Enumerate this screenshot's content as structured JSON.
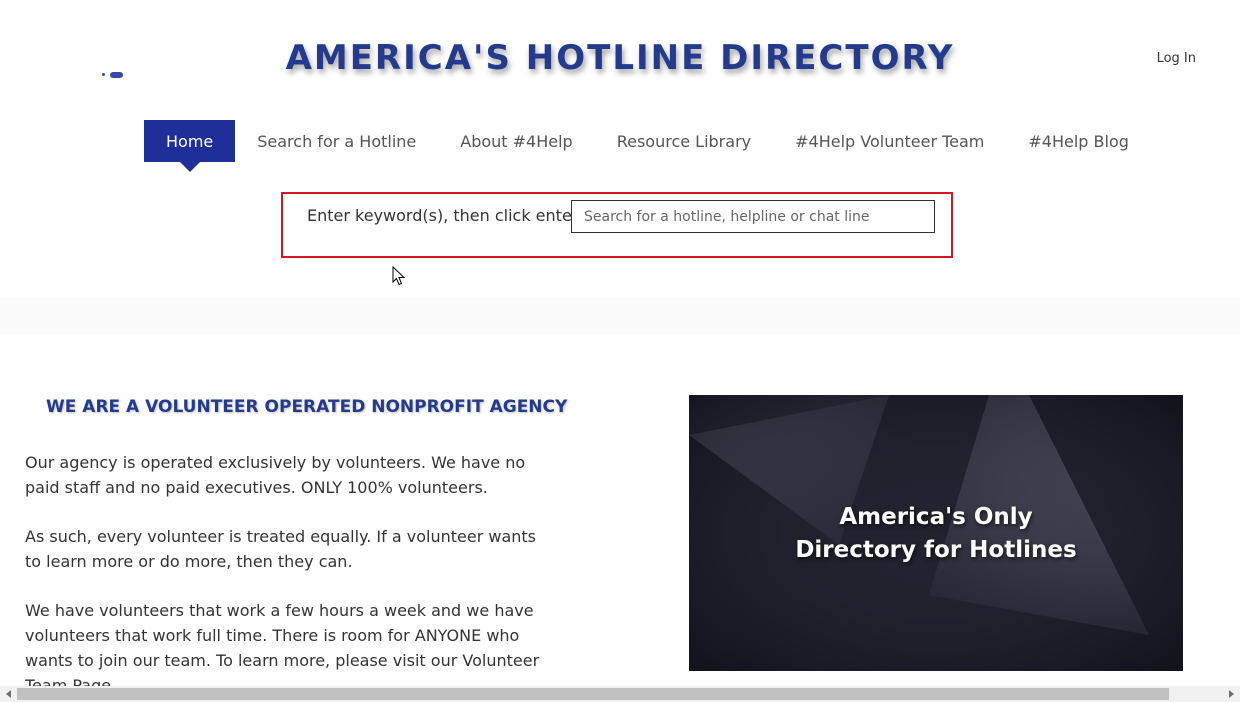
{
  "header": {
    "site_title": "AMERICA'S HOTLINE DIRECTORY",
    "login_label": "Log In"
  },
  "nav": {
    "items": [
      {
        "label": "Home",
        "active": true
      },
      {
        "label": "Search for a Hotline",
        "active": false
      },
      {
        "label": "About #4Help",
        "active": false
      },
      {
        "label": "Resource Library",
        "active": false
      },
      {
        "label": "#4Help Volunteer Team",
        "active": false
      },
      {
        "label": "#4Help Blog",
        "active": false
      }
    ]
  },
  "search": {
    "label": "Enter keyword(s), then click enter",
    "placeholder": "Search for a hotline, helpline or chat line",
    "value": ""
  },
  "about": {
    "heading": "WE ARE A VOLUNTEER OPERATED NONPROFIT AGENCY",
    "paragraphs": [
      "Our agency is operated exclusively by volunteers. We have no paid staff and no paid executives. ONLY 100% volunteers.",
      "As such, every volunteer is treated equally. If a volunteer wants to learn more or do more, then they can.",
      "We have volunteers that work a few hours a week and we have volunteers that work full time. There is room for ANYONE who wants to join our team. To learn more, please visit our Volunteer Team Page."
    ]
  },
  "hero": {
    "caption_line1": "America's Only",
    "caption_line2": "Directory for Hotlines"
  },
  "colors": {
    "brand_blue": "#243a8c",
    "nav_active": "#1f2f9a",
    "highlight_border": "#d9151d"
  }
}
